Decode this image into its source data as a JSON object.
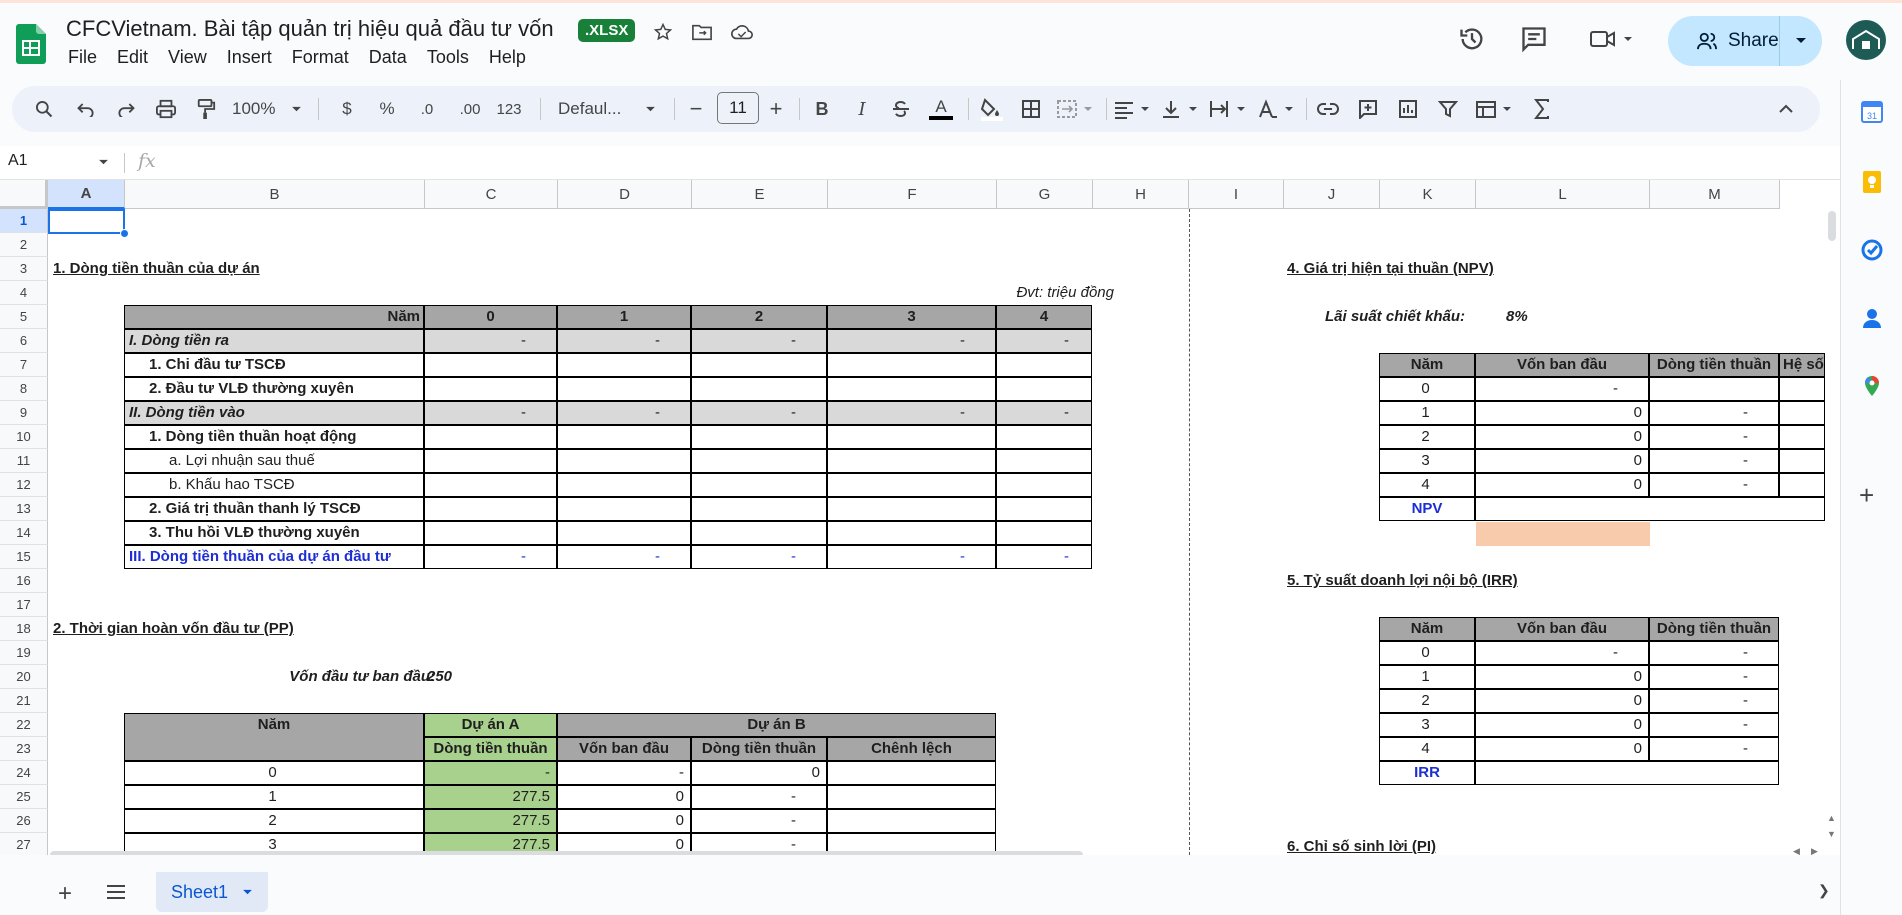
{
  "doc": {
    "title": "CFCVietnam. Bài tập quản trị hiệu quả đầu tư vốn",
    "badge": ".XLSX"
  },
  "menu": [
    "File",
    "Edit",
    "View",
    "Insert",
    "Format",
    "Data",
    "Tools",
    "Help"
  ],
  "share_label": "Share",
  "toolbar": {
    "zoom": "100%",
    "currency": "$",
    "percent": "%",
    "dec_less": ".0",
    "dec_more": ".00",
    "number_format": "123",
    "font": "Defaul...",
    "font_size": "11",
    "bold": "B",
    "italic": "I",
    "text_color": "A"
  },
  "formula": {
    "name_box": "A1",
    "fx": "fx"
  },
  "columns": [
    "A",
    "B",
    "C",
    "D",
    "E",
    "F",
    "G",
    "H",
    "I",
    "J",
    "K",
    "L",
    "M"
  ],
  "rows": [
    "1",
    "2",
    "3",
    "4",
    "5",
    "6",
    "7",
    "8",
    "9",
    "10",
    "11",
    "12",
    "13",
    "14",
    "15",
    "16",
    "17",
    "18",
    "19",
    "20",
    "21",
    "22",
    "23",
    "24",
    "25",
    "26",
    "27"
  ],
  "sheet": {
    "s1": {
      "title": "1. Dòng tiền thuần của dự án",
      "unit": "Đvt: triệu đồng",
      "header": [
        "Năm",
        "0",
        "1",
        "2",
        "3",
        "4"
      ],
      "rows": [
        [
          "I. Dòng tiền ra",
          "-",
          "-",
          "-",
          "-",
          "-"
        ],
        [
          "1. Chi đầu tư TSCĐ",
          "",
          "",
          "",
          "",
          ""
        ],
        [
          "2. Đầu tư VLĐ thường xuyên",
          "",
          "",
          "",
          "",
          ""
        ],
        [
          "II. Dòng tiền vào",
          "-",
          "-",
          "-",
          "-",
          "-"
        ],
        [
          "1. Dòng tiền thuần hoạt động",
          "",
          "",
          "",
          "",
          ""
        ],
        [
          "a. Lợi nhuận sau thuế",
          "",
          "",
          "",
          "",
          ""
        ],
        [
          "b. Khấu hao TSCĐ",
          "",
          "",
          "",
          "",
          ""
        ],
        [
          "2. Giá trị thuần thanh lý TSCĐ",
          "",
          "",
          "",
          "",
          ""
        ],
        [
          "3. Thu hồi VLĐ thường xuyên",
          "",
          "",
          "",
          "",
          ""
        ],
        [
          "III. Dòng tiền thuần của dự án đầu tư",
          "-",
          "-",
          "-",
          "-",
          "-"
        ]
      ]
    },
    "s2": {
      "title": "2. Thời gian hoàn vốn đầu tư (PP)",
      "capital_label": "Vốn đầu tư ban đầu:",
      "capital_value": "250",
      "header_top": [
        "Năm",
        "Dự án A",
        "Dự án B"
      ],
      "header_sub": [
        "Dòng tiền thuần",
        "Vốn ban đầu",
        "Dòng tiền thuần",
        "Chênh lệch"
      ],
      "rows": [
        [
          "0",
          "-",
          "-",
          "0",
          ""
        ],
        [
          "1",
          "277.5",
          "0",
          "-",
          ""
        ],
        [
          "2",
          "277.5",
          "0",
          "-",
          ""
        ],
        [
          "3",
          "277.5",
          "0",
          "-",
          ""
        ]
      ]
    },
    "s4": {
      "title": "4. Giá trị hiện tại thuần (NPV)",
      "rate_label": "Lãi suất chiết khấu:",
      "rate_value": "8%",
      "header": [
        "Năm",
        "Vốn ban đầu",
        "Dòng tiền thuần",
        "Hệ số"
      ],
      "rows": [
        [
          "0",
          "-",
          ""
        ],
        [
          "1",
          "0",
          "-"
        ],
        [
          "2",
          "0",
          "-"
        ],
        [
          "3",
          "0",
          "-"
        ],
        [
          "4",
          "0",
          "-"
        ]
      ],
      "npv_label": "NPV"
    },
    "s5": {
      "title": "5. Tỷ suất doanh lợi nội bộ (IRR)",
      "header": [
        "Năm",
        "Vốn ban đầu",
        "Dòng tiền thuần"
      ],
      "rows": [
        [
          "0",
          "-",
          "-"
        ],
        [
          "1",
          "0",
          "-"
        ],
        [
          "2",
          "0",
          "-"
        ],
        [
          "3",
          "0",
          "-"
        ],
        [
          "4",
          "0",
          "-"
        ]
      ],
      "irr_label": "IRR"
    },
    "s6": {
      "title": "6. Chỉ số sinh lời (PI)"
    }
  },
  "sheet_tab": "Sheet1",
  "colors": {
    "header_gray": "#a6a6a6",
    "row_gray": "#d9d9d9",
    "green": "#a9d18e",
    "peach": "#f8cbad",
    "blue_text": "#1d2ed3",
    "share_bg": "#c2e7ff",
    "toolbar_bg": "#edf2fa"
  }
}
